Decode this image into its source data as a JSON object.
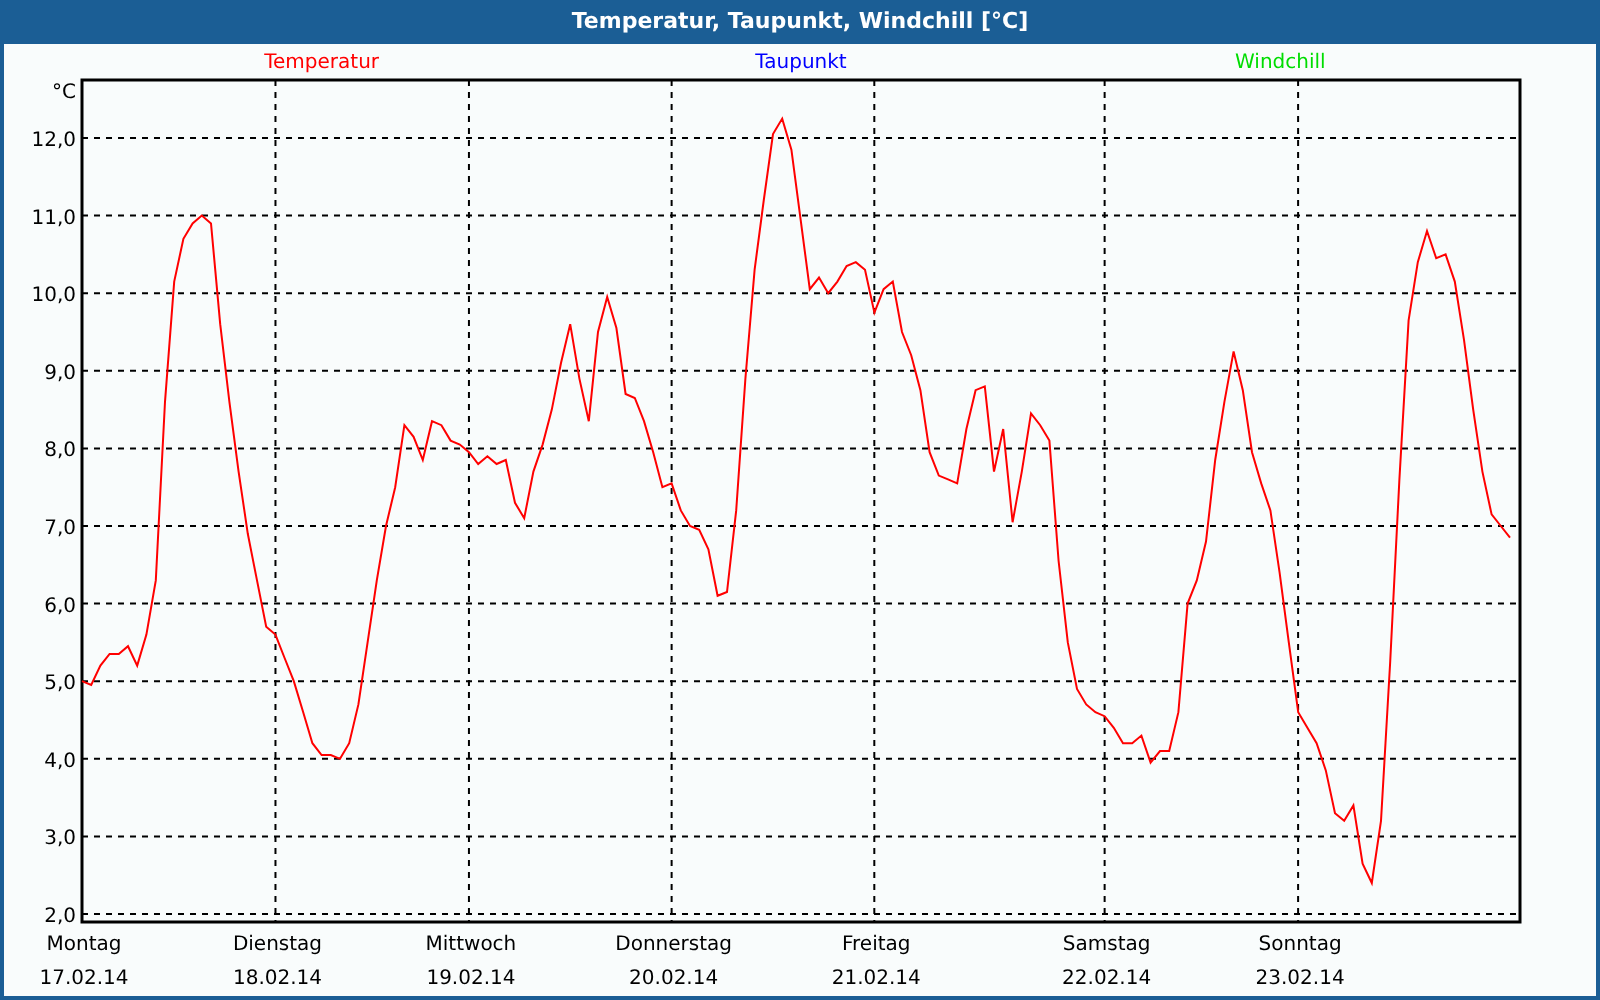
{
  "window": {
    "title": "Temperatur, Taupunkt, Windchill [°C]"
  },
  "chart": {
    "dates": [
      "17.02.14",
      "18.02.14",
      "19.02.14",
      "20.02.14",
      "21.02.14",
      "22.02.14",
      "23.02.14"
    ],
    "chart_data": {
      "type": "line",
      "grid": true,
      "ylabel": "°C",
      "ylim": [
        1.897,
        12.747
      ],
      "categories": [
        "Montag",
        null,
        null,
        null,
        null,
        null,
        null,
        null,
        null,
        null,
        null,
        null,
        null,
        null,
        null,
        null,
        null,
        null,
        null,
        null,
        null,
        "Dienstag",
        null,
        null,
        null,
        null,
        null,
        null,
        null,
        null,
        null,
        null,
        null,
        null,
        null,
        null,
        null,
        null,
        null,
        null,
        null,
        null,
        "Mittwoch",
        null,
        null,
        null,
        null,
        null,
        null,
        null,
        null,
        null,
        null,
        null,
        null,
        null,
        null,
        null,
        null,
        null,
        null,
        null,
        null,
        null,
        "Donnerstag",
        null,
        null,
        null,
        null,
        null,
        null,
        null,
        null,
        null,
        null,
        null,
        null,
        null,
        null,
        null,
        null,
        null,
        null,
        null,
        null,
        null,
        "Freitag",
        null,
        null,
        null,
        null,
        null,
        null,
        null,
        null,
        null,
        null,
        null,
        null,
        null,
        null,
        null,
        null,
        null,
        null,
        null,
        null,
        null,
        null,
        null,
        null,
        "Samstag",
        null,
        null,
        null,
        null,
        null,
        null,
        null,
        null,
        null,
        null,
        null,
        null,
        null,
        null,
        null,
        null,
        null,
        null,
        null,
        null,
        "Sonntag",
        null,
        null,
        null,
        null,
        null,
        null,
        null,
        null,
        null,
        null,
        null,
        null,
        null,
        null,
        null,
        null,
        null,
        null,
        null,
        null,
        null,
        null,
        null
      ],
      "yticks": [
        {
          "value": 2,
          "label": "2,0"
        },
        {
          "value": 3,
          "label": "3,0"
        },
        {
          "value": 4,
          "label": "4,0"
        },
        {
          "value": 5,
          "label": "5,0"
        },
        {
          "value": 6,
          "label": "6,0"
        },
        {
          "value": 7,
          "label": "7,0"
        },
        {
          "value": 8,
          "label": "8,0"
        },
        {
          "value": 9,
          "label": "9,0"
        },
        {
          "value": 10,
          "label": "10,0"
        },
        {
          "value": 11,
          "label": "11,0"
        },
        {
          "value": 12,
          "label": "12,0"
        }
      ],
      "series": [
        {
          "name": "Temperatur",
          "color": "#ff0000",
          "values": [
            5.0,
            4.95,
            5.2,
            5.35,
            5.35,
            5.45,
            5.2,
            5.6,
            6.3,
            8.6,
            10.15,
            10.7,
            10.9,
            11.0,
            10.9,
            9.6,
            8.6,
            7.7,
            6.9,
            6.3,
            5.7,
            5.6,
            5.3,
            5.0,
            4.6,
            4.2,
            4.05,
            4.05,
            4.0,
            4.2,
            4.7,
            5.5,
            6.3,
            7.0,
            7.5,
            8.3,
            8.15,
            7.85,
            8.35,
            8.3,
            8.1,
            8.05,
            7.95,
            7.8,
            7.9,
            7.8,
            7.85,
            7.3,
            7.1,
            7.7,
            8.05,
            8.5,
            9.1,
            9.6,
            8.9,
            8.35,
            9.5,
            9.95,
            9.55,
            8.7,
            8.65,
            8.35,
            7.95,
            7.5,
            7.55,
            7.2,
            7.0,
            6.95,
            6.7,
            6.1,
            6.15,
            7.2,
            8.9,
            10.3,
            11.2,
            12.05,
            12.25,
            11.85,
            10.95,
            10.05,
            10.2,
            10.0,
            10.15,
            10.35,
            10.4,
            10.3,
            9.75,
            10.05,
            10.15,
            9.5,
            9.2,
            8.75,
            7.95,
            7.65,
            7.6,
            7.55,
            8.25,
            8.75,
            8.8,
            7.7,
            8.25,
            7.05,
            7.7,
            8.45,
            8.3,
            8.1,
            6.55,
            5.5,
            4.9,
            4.7,
            4.6,
            4.55,
            4.4,
            4.2,
            4.2,
            4.3,
            3.95,
            4.1,
            4.1,
            4.6,
            6.0,
            6.3,
            6.8,
            7.85,
            8.6,
            9.25,
            8.75,
            7.95,
            7.55,
            7.2,
            6.4,
            5.5,
            4.6,
            4.4,
            4.2,
            3.85,
            3.3,
            3.2,
            3.4,
            2.65,
            2.4,
            3.2,
            5.25,
            7.6,
            9.65,
            10.4,
            10.8,
            10.45,
            10.5,
            10.15,
            9.4,
            8.5,
            7.7,
            7.15,
            7.0,
            6.85
          ]
        },
        {
          "name": "Taupunkt",
          "color": "#0000ff",
          "values": [
            null,
            null,
            null,
            null,
            null,
            null,
            null,
            null,
            null,
            null,
            null,
            null,
            null,
            null,
            null,
            null,
            null,
            null,
            null,
            null,
            null,
            null,
            null,
            null,
            null,
            null,
            null,
            null,
            null,
            null,
            null,
            null,
            null,
            null,
            null,
            null,
            null,
            null,
            null,
            null,
            null,
            null,
            null,
            null,
            null,
            null,
            null,
            null,
            null,
            null,
            null,
            null,
            null,
            null,
            null,
            null,
            null,
            null,
            null,
            null,
            null,
            null,
            null,
            null,
            null,
            null,
            null,
            null,
            null,
            null,
            null,
            null,
            null,
            null,
            null,
            null,
            null,
            null,
            null,
            null,
            null,
            null,
            null,
            null,
            null,
            null,
            null,
            null,
            null,
            null,
            null,
            null,
            null,
            null,
            null,
            null,
            null,
            null,
            null,
            null,
            null,
            null,
            null,
            null,
            null,
            null,
            null,
            null,
            null,
            null,
            null,
            null,
            null,
            null,
            null,
            null,
            null,
            null,
            null,
            null,
            null,
            null,
            null,
            null,
            null,
            null,
            null,
            null,
            null,
            null,
            null,
            null,
            null,
            null,
            null,
            null,
            null,
            null,
            null,
            null,
            null,
            null,
            null,
            null,
            null,
            null,
            null,
            null,
            null,
            null,
            null,
            null,
            null,
            null,
            null,
            null
          ]
        },
        {
          "name": "Windchill",
          "color": "#00dd00",
          "values": [
            null,
            null,
            null,
            null,
            null,
            null,
            null,
            null,
            null,
            null,
            null,
            null,
            null,
            null,
            null,
            null,
            null,
            null,
            null,
            null,
            null,
            null,
            null,
            null,
            null,
            null,
            null,
            null,
            null,
            null,
            null,
            null,
            null,
            null,
            null,
            null,
            null,
            null,
            null,
            null,
            null,
            null,
            null,
            null,
            null,
            null,
            null,
            null,
            null,
            null,
            null,
            null,
            null,
            null,
            null,
            null,
            null,
            null,
            null,
            null,
            null,
            null,
            null,
            null,
            null,
            null,
            null,
            null,
            null,
            null,
            null,
            null,
            null,
            null,
            null,
            null,
            null,
            null,
            null,
            null,
            null,
            null,
            null,
            null,
            null,
            null,
            null,
            null,
            null,
            null,
            null,
            null,
            null,
            null,
            null,
            null,
            null,
            null,
            null,
            null,
            null,
            null,
            null,
            null,
            null,
            null,
            null,
            null,
            null,
            null,
            null,
            null,
            null,
            null,
            null,
            null,
            null,
            null,
            null,
            null,
            null,
            null,
            null,
            null,
            null,
            null,
            null,
            null,
            null,
            null,
            null,
            null,
            null,
            null,
            null,
            null,
            null,
            null,
            null,
            null,
            null,
            null,
            null,
            null,
            null,
            null,
            null,
            null,
            null,
            null,
            null,
            null,
            null,
            null,
            null,
            null
          ]
        }
      ]
    }
  }
}
